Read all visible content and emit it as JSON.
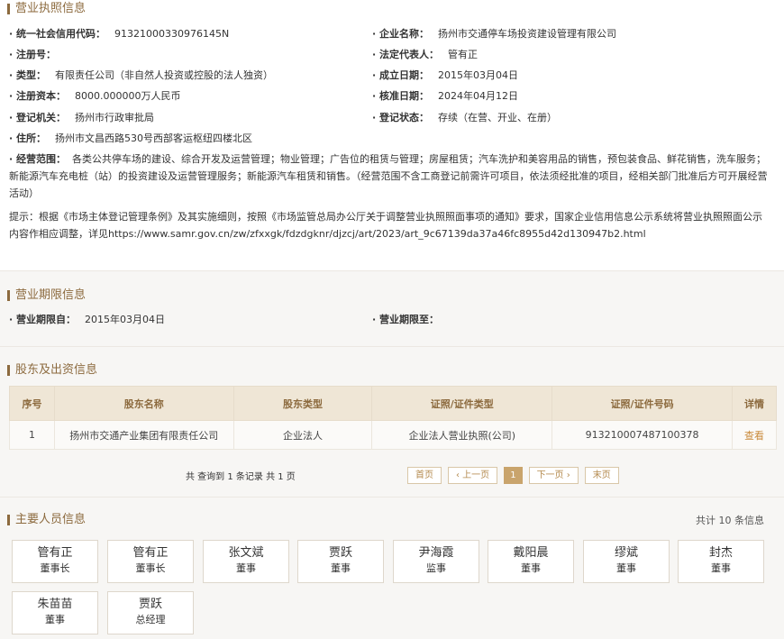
{
  "license": {
    "title": "营业执照信息",
    "fields": [
      {
        "label": "统一社会信用代码：",
        "value": "91321000330976145N"
      },
      {
        "label": "企业名称：",
        "value": "扬州市交通停车场投资建设管理有限公司"
      },
      {
        "label": "注册号：",
        "value": ""
      },
      {
        "label": "法定代表人：",
        "value": "管有正"
      },
      {
        "label": "类型：",
        "value": "有限责任公司（非自然人投资或控股的法人独资）"
      },
      {
        "label": "成立日期：",
        "value": "2015年03月04日"
      },
      {
        "label": "注册资本：",
        "value": "8000.000000万人民币"
      },
      {
        "label": "核准日期：",
        "value": "2024年04月12日"
      },
      {
        "label": "登记机关：",
        "value": "扬州市行政审批局"
      },
      {
        "label": "登记状态：",
        "value": "存续（在营、开业、在册）"
      },
      {
        "label": "住所：",
        "value": "扬州市文昌西路530号西部客运枢纽四楼北区"
      }
    ],
    "scope_label": "经营范围：",
    "scope_value": "各类公共停车场的建设、综合开发及运营管理；物业管理；广告位的租赁与管理；房屋租赁；汽车洗护和美容用品的销售，预包装食品、鲜花销售，洗车服务；新能源汽车充电桩（站）的投资建设及运营管理服务；新能源汽车租赁和销售。（经营范围不含工商登记前需许可项目，依法须经批准的项目，经相关部门批准后方可开展经营活动）",
    "notice": "提示：根据《市场主体登记管理条例》及其实施细则，按照《市场监管总局办公厅关于调整营业执照照面事项的通知》要求，国家企业信用信息公示系统将营业执照照面公示内容作相应调整，详见https://www.samr.gov.cn/zw/zfxxgk/fdzdgknr/djzcj/art/2023/art_9c67139da37a46fc8955d42d130947b2.html"
  },
  "term": {
    "title": "营业期限信息",
    "from_label": "营业期限自：",
    "from_value": "2015年03月04日",
    "to_label": "营业期限至：",
    "to_value": ""
  },
  "shareholders": {
    "title": "股东及出资信息",
    "headers": [
      "序号",
      "股东名称",
      "股东类型",
      "证照/证件类型",
      "证照/证件号码",
      "详情"
    ],
    "rows": [
      [
        "1",
        "扬州市交通产业集团有限责任公司",
        "企业法人",
        "企业法人营业执照(公司)",
        "913210007487100378",
        "查看"
      ]
    ],
    "count_text": "共 查询到 1 条记录 共 1 页",
    "pager": {
      "first": "首页",
      "prev": "‹ 上一页",
      "current": "1",
      "next": "下一页 ›",
      "last": "末页"
    }
  },
  "people": {
    "title": "主要人员信息",
    "total": "共计 10 条信息",
    "items": [
      {
        "name": "管有正",
        "role": "董事长"
      },
      {
        "name": "管有正",
        "role": "董事长"
      },
      {
        "name": "张文斌",
        "role": "董事"
      },
      {
        "name": "贾跃",
        "role": "董事"
      },
      {
        "name": "尹海霞",
        "role": "监事"
      },
      {
        "name": "戴阳晨",
        "role": "董事"
      },
      {
        "name": "缪斌",
        "role": "董事"
      },
      {
        "name": "封杰",
        "role": "董事"
      },
      {
        "name": "朱苗苗",
        "role": "董事"
      },
      {
        "name": "贾跃",
        "role": "总经理"
      }
    ]
  }
}
